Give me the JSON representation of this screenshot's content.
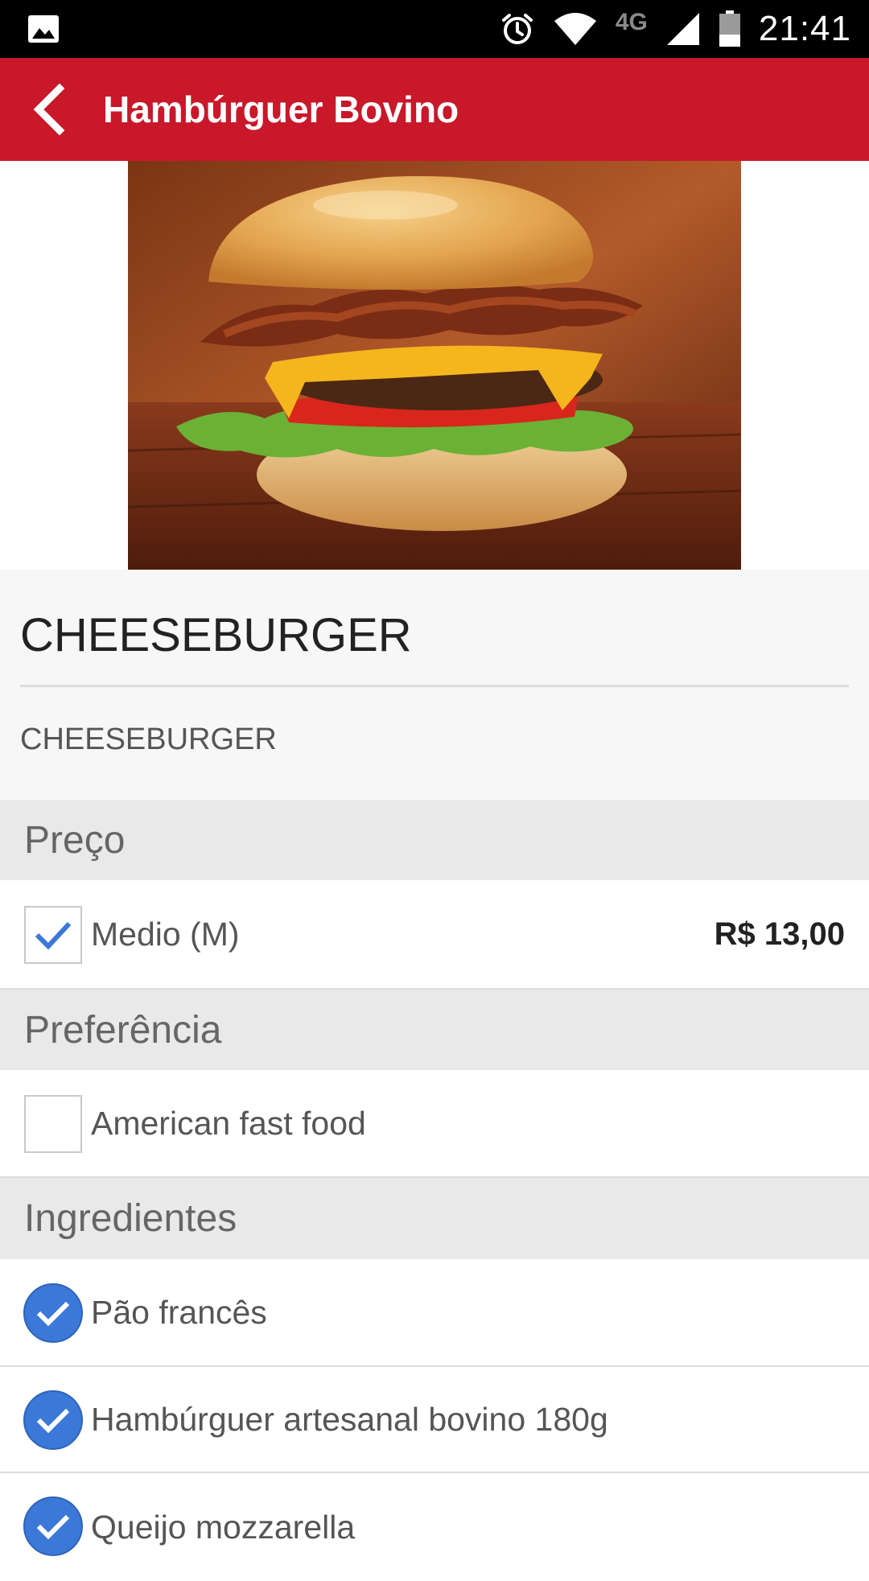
{
  "status_bar": {
    "time": "21:41",
    "network": "4G",
    "icons": [
      "image-icon",
      "alarm-icon",
      "wifi-icon",
      "signal-icon",
      "battery-icon"
    ]
  },
  "app_bar": {
    "title": "Hambúrguer Bovino",
    "color": "#c8182a",
    "back_icon": "chevron-left-icon"
  },
  "product": {
    "name": "CHEESEBURGER",
    "description": "CHEESEBURGER"
  },
  "sections": {
    "price": {
      "header": "Preço",
      "options": [
        {
          "label": "Medio (M)",
          "price": "R$ 13,00",
          "checked": true
        }
      ]
    },
    "preference": {
      "header": "Preferência",
      "options": [
        {
          "label": "American fast food",
          "checked": false
        }
      ]
    },
    "ingredients": {
      "header": "Ingredientes",
      "items": [
        {
          "label": "Pão francês",
          "checked": true
        },
        {
          "label": "Hambúrguer artesanal bovino 180g",
          "checked": true
        },
        {
          "label": "Queijo mozzarella",
          "checked": true
        }
      ]
    }
  },
  "colors": {
    "accent": "#c8182a",
    "check_blue": "#3b78d8"
  }
}
